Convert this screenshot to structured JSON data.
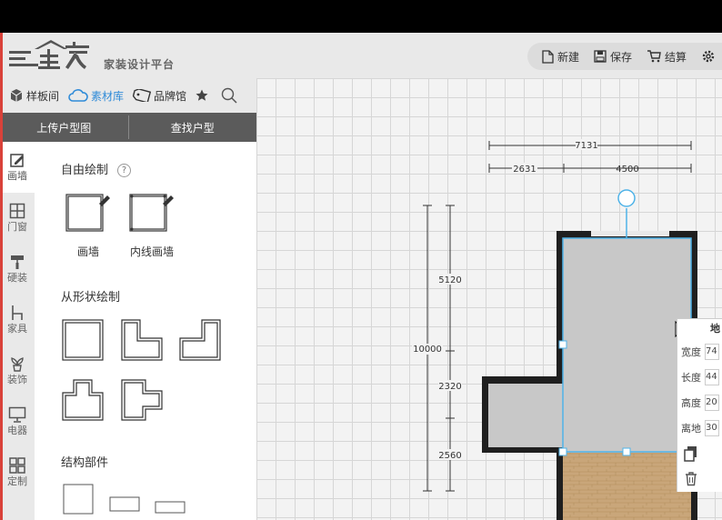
{
  "app": {
    "logo_text": "家装设计平台"
  },
  "toolbar": {
    "new_label": "新建",
    "save_label": "保存",
    "checkout_label": "结算"
  },
  "tabs": {
    "samples": "样板间",
    "library": "素材库",
    "brands": "品牌馆"
  },
  "actions": {
    "upload_floorplan": "上传户型图",
    "find_floorplan": "查找户型"
  },
  "side_nav": [
    {
      "label": "画墙",
      "icon": "pencil-icon"
    },
    {
      "label": "门窗",
      "icon": "window-icon"
    },
    {
      "label": "硬装",
      "icon": "paint-roller-icon"
    },
    {
      "label": "家具",
      "icon": "chair-icon"
    },
    {
      "label": "装饰",
      "icon": "plant-icon"
    },
    {
      "label": "电器",
      "icon": "monitor-icon"
    },
    {
      "label": "定制",
      "icon": "grid-icon"
    }
  ],
  "panel": {
    "free_draw_title": "自由绘制",
    "help_mark": "?",
    "draw_wall": "画墙",
    "draw_inner_wall": "内线画墙",
    "shape_draw_title": "从形状绘制",
    "structure_title": "结构部件"
  },
  "dimensions": {
    "top_total": "7131",
    "top_left": "2631",
    "top_right": "4500",
    "left_total": "10000",
    "seg_1": "5120",
    "seg_2": "2320",
    "seg_3": "2560"
  },
  "properties": {
    "header": "地",
    "rows": [
      {
        "label": "宽度",
        "value": "74"
      },
      {
        "label": "长度",
        "value": "44"
      },
      {
        "label": "高度",
        "value": "20"
      },
      {
        "label": "离地",
        "value": "30"
      }
    ]
  },
  "colors": {
    "accent": "#2f8bd8",
    "wall": "#222222",
    "room_fill": "#c8c8c8",
    "wood": "#c9a67a",
    "selection": "#4fb3e8"
  }
}
